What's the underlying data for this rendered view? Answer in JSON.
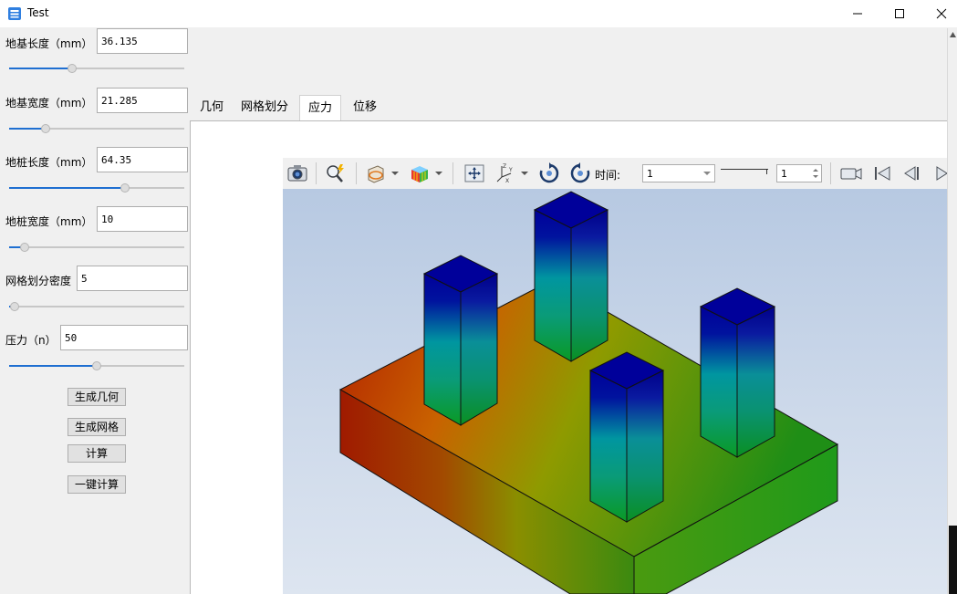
{
  "window": {
    "title": "Test",
    "controls": [
      "minimize",
      "maximize",
      "close"
    ]
  },
  "params": [
    {
      "label": "地基长度（mm）",
      "value": "36.135",
      "slider_fraction": 0.36
    },
    {
      "label": "地基宽度（mm）",
      "value": "21.285",
      "slider_fraction": 0.21
    },
    {
      "label": "地桩长度（mm）",
      "value": "64.35",
      "slider_fraction": 0.66
    },
    {
      "label": "地桩宽度（mm）",
      "value": "10",
      "slider_fraction": 0.09
    },
    {
      "label": "网格划分密度",
      "value": "5",
      "slider_fraction": 0.03
    },
    {
      "label": "压力（n）",
      "value": "50",
      "slider_fraction": 0.5
    }
  ],
  "buttons": {
    "generate_geometry": "生成几何",
    "generate_mesh": "生成网格",
    "compute": "计算",
    "one_click_compute": "一键计算"
  },
  "tabs": [
    {
      "label": "几何",
      "active": false
    },
    {
      "label": "网格划分",
      "active": false
    },
    {
      "label": "应力",
      "active": true
    },
    {
      "label": "位移",
      "active": false
    }
  ],
  "toolbar": {
    "time_label": "时间:",
    "time_select_value": "1",
    "step_spinner_value": "1",
    "icons": [
      "camera-icon",
      "zoom-probe-icon",
      "clip-plane-icon",
      "color-cube-icon",
      "fit-view-icon",
      "axes-icon",
      "rotate-cw-icon",
      "rotate-ccw-icon",
      "record-video-icon",
      "first-frame-icon",
      "previous-frame-icon",
      "play-icon"
    ]
  },
  "colors": {
    "accent": "#1f6fd1",
    "background_top": "#b7c9e2",
    "background_bottom": "#dde5f0",
    "stress_high": "#b01d00",
    "stress_mid": "#8f9a00",
    "stress_low": "#1f8e16",
    "pile_top": "#00009a",
    "pile_mid": "#0096a0"
  }
}
